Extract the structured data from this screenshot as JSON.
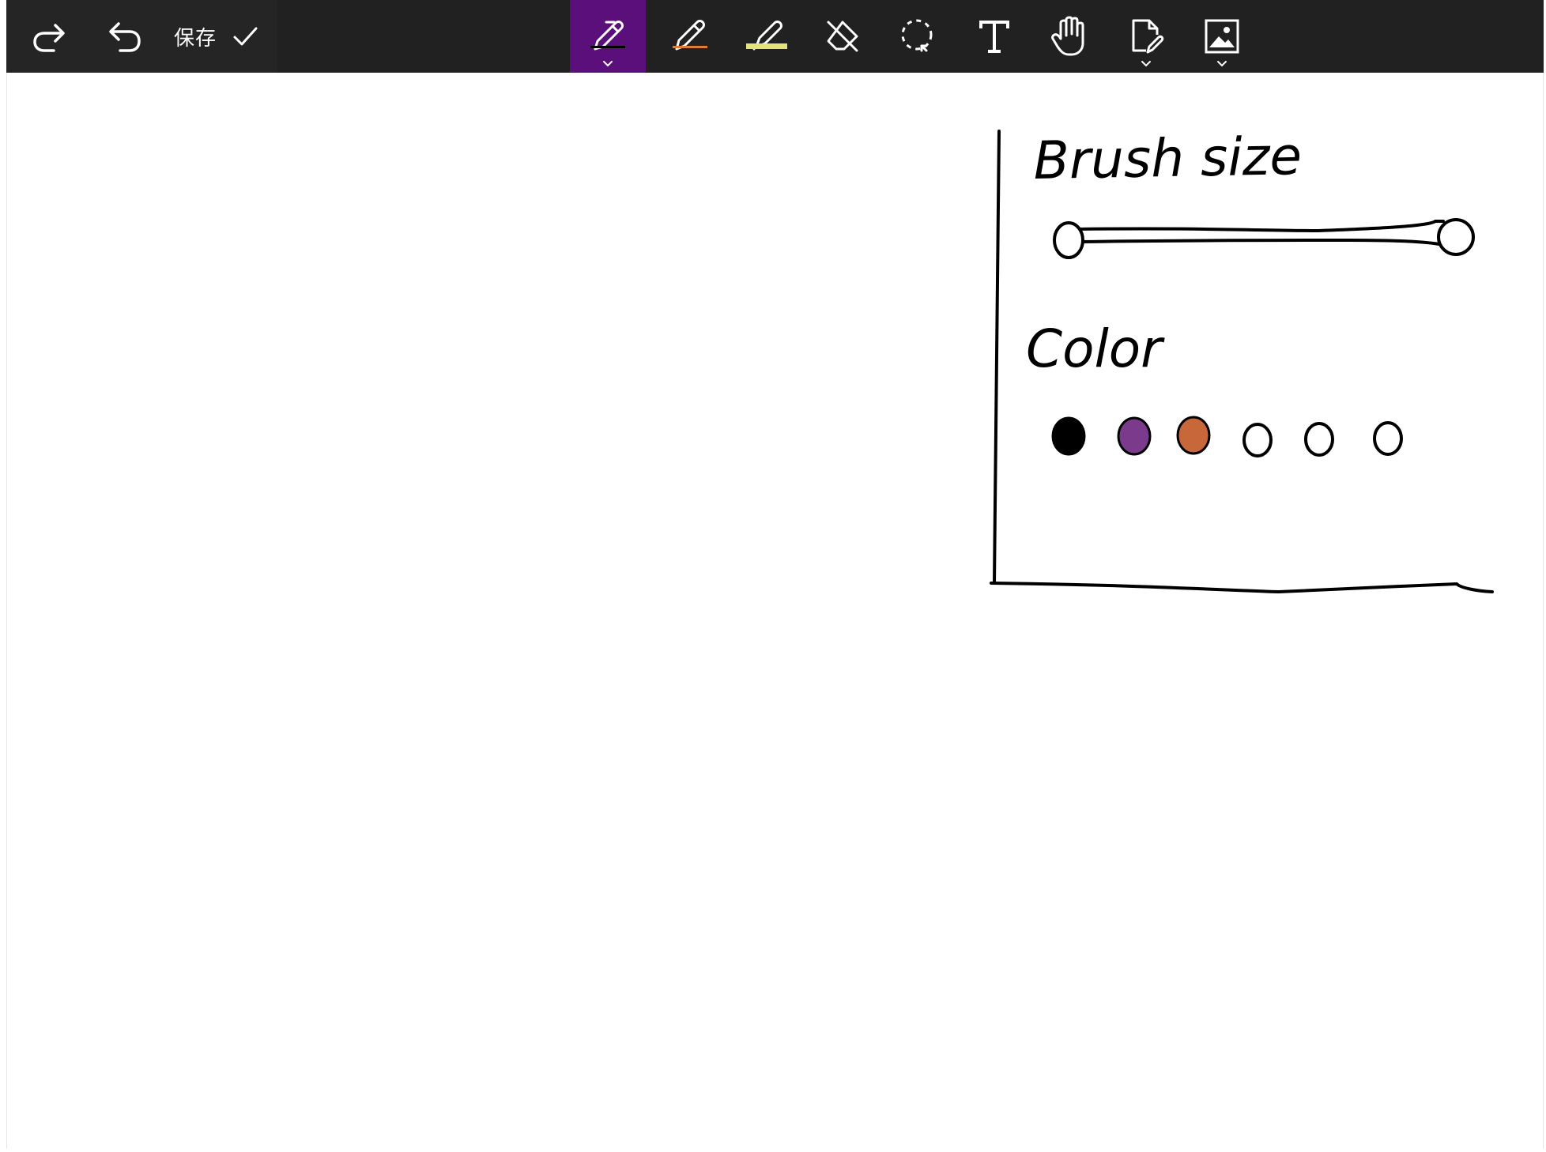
{
  "toolbar": {
    "save_label": "保存",
    "buttons": [
      {
        "name": "redo",
        "icon": "redo-icon"
      },
      {
        "name": "undo",
        "icon": "undo-icon"
      },
      {
        "name": "save",
        "icon": "check-icon"
      },
      {
        "name": "ballpoint-pen",
        "icon": "pen-icon",
        "active": true,
        "underline_color": "#000000",
        "has_dropdown": true
      },
      {
        "name": "pencil",
        "icon": "pencil-icon",
        "underline_color": "#e07b39"
      },
      {
        "name": "highlighter",
        "icon": "highlighter-icon",
        "underline_color": "#e3e37a"
      },
      {
        "name": "eraser",
        "icon": "eraser-icon"
      },
      {
        "name": "lasso-select",
        "icon": "lasso-icon"
      },
      {
        "name": "text",
        "icon": "text-icon"
      },
      {
        "name": "touch-writing",
        "icon": "hand-icon"
      },
      {
        "name": "page",
        "icon": "page-edit-icon",
        "has_dropdown": true
      },
      {
        "name": "image",
        "icon": "image-icon",
        "has_dropdown": true
      }
    ],
    "colors": {
      "bar": "#212121",
      "active": "#5b0f7a",
      "icon": "#ffffff"
    }
  },
  "sketch": {
    "brush_size_label": "Brush size",
    "color_label": "Color",
    "swatches": [
      {
        "fill": "#000000",
        "filled": true
      },
      {
        "fill": "#7b3a8c",
        "filled": true
      },
      {
        "fill": "#c8673a",
        "filled": true
      },
      {
        "fill": "#ffffff",
        "filled": false
      },
      {
        "fill": "#ffffff",
        "filled": false
      },
      {
        "fill": "#ffffff",
        "filled": false
      }
    ]
  }
}
